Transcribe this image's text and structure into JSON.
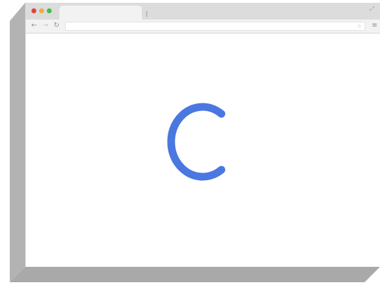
{
  "window": {
    "traffic_lights": {
      "close_color": "#e0443e",
      "minimize_color": "#e3b339",
      "zoom_color": "#3fbf4a"
    },
    "tab": {
      "title": ""
    },
    "address_bar": {
      "value": ""
    }
  },
  "toolbar": {
    "back_icon": "arrow-left-icon",
    "forward_icon": "arrow-right-icon",
    "reload_icon": "reload-icon",
    "bookmark_icon": "star-icon",
    "menu_icon": "hamburger-menu-icon"
  },
  "content": {
    "logo_letter": "C",
    "logo_color": "#4a78e0"
  },
  "colors": {
    "slab": "#b3b3b3",
    "chrome": "#dcdcdc",
    "toolbar": "#f2f2f2"
  }
}
